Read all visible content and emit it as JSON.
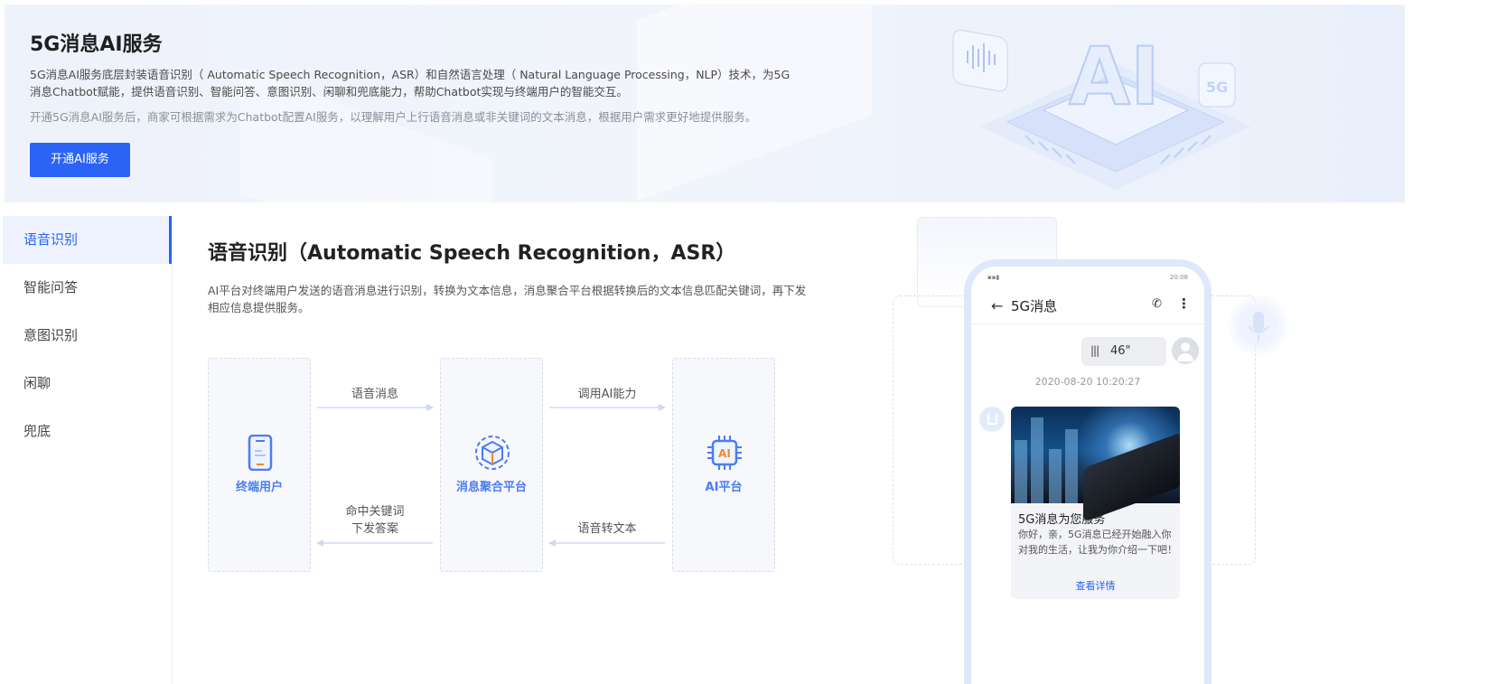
{
  "banner": {
    "title": "5G消息AI服务",
    "description": "5G消息AI服务底层封装语音识别（ Automatic Speech Recognition，ASR）和自然语言处理（ Natural Language Processing，NLP）技术，为5G消息Chatbot赋能，提供语音识别、智能问答、意图识别、闲聊和兜底能力，帮助Chatbot实现与终端用户的智能交互。",
    "note": "开通5G消息AI服务后，商家可根据需求为Chatbot配置AI服务，以理解用户上行语音消息或非关键词的文本消息，根据用户需求更好地提供服务。",
    "button": "开通AI服务",
    "illustration_text": "AI",
    "illustration_badge": "5G"
  },
  "sidebar": {
    "items": [
      {
        "label": "语音识别",
        "active": true
      },
      {
        "label": "智能问答",
        "active": false
      },
      {
        "label": "意图识别",
        "active": false
      },
      {
        "label": "闲聊",
        "active": false
      },
      {
        "label": "兜底",
        "active": false
      }
    ]
  },
  "main": {
    "title": "语音识别（Automatic Speech Recognition，ASR）",
    "description": "AI平台对终端用户发送的语音消息进行识别，转换为文本信息，消息聚合平台根据转换后的文本信息匹配关键词，再下发相应信息提供服务。",
    "flow": {
      "nodes": [
        {
          "label": "终端用户",
          "icon": "phone-icon"
        },
        {
          "label": "消息聚合平台",
          "icon": "cube-icon"
        },
        {
          "label": "AI平台",
          "icon": "ai-chip-icon"
        }
      ],
      "arrows": {
        "user_to_platform": "语音消息",
        "platform_to_ai": "调用AI能力",
        "platform_to_user_line1": "命中关键词",
        "platform_to_user_line2": "下发答案",
        "ai_to_platform": "语音转文本"
      },
      "ai_chip_text": "AI"
    }
  },
  "phone": {
    "status_time": "20:08",
    "title": "5G消息",
    "back_glyph": "←",
    "call_glyph": "✆",
    "more_glyph": "⋮",
    "voice_duration": "46\"",
    "timestamp": "2020-08-20 10:20:27",
    "card": {
      "title": "5G消息为您服务",
      "text": "你好，亲，5G消息已经开始融入你对我的生活，让我为你介绍一下吧！",
      "link": "查看详情"
    }
  },
  "colors": {
    "accent": "#2b63f6",
    "flow_label": "#4c7cf2",
    "ai_orange": "#f08a24"
  }
}
